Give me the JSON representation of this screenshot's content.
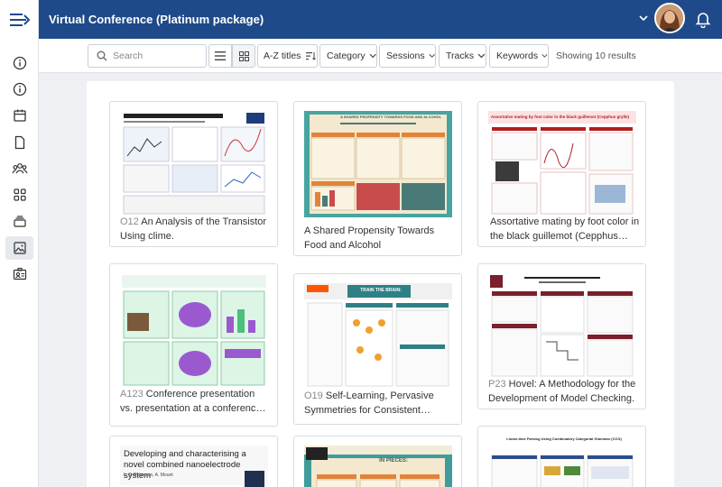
{
  "header": {
    "title": "Virtual Conference (Platinum package)"
  },
  "sidebar": {
    "items": [
      {
        "icon": "info-icon"
      },
      {
        "icon": "info-icon"
      },
      {
        "icon": "calendar-icon"
      },
      {
        "icon": "document-icon"
      },
      {
        "icon": "people-icon"
      },
      {
        "icon": "apps-grid-icon"
      },
      {
        "icon": "stack-icon"
      },
      {
        "icon": "image-icon",
        "active": true
      },
      {
        "icon": "badge-icon"
      }
    ]
  },
  "toolbar": {
    "search_placeholder": "Search",
    "sort_label": "A-Z titles",
    "filters": {
      "category": "Category",
      "sessions": "Sessions",
      "tracks": "Tracks",
      "keywords": "Keywords"
    },
    "results": "Showing 10 results"
  },
  "posters": [
    {
      "code": "O12",
      "title": "An Analysis of the Transistor Using clime."
    },
    {
      "code": "",
      "title": "A Shared Propensity Towards Food and Alcohol",
      "poster_header": "A SHARED PROPENSITY TOWARDS FOOD AND ALCOHOL"
    },
    {
      "code": "",
      "title": "Assortative mating by foot color in the black guillemot (Cepphus grylle)",
      "poster_header": "Assortative mating by foot color in the black guillemot (Cepphus grylle)"
    },
    {
      "code": "A123",
      "title": "Conference presentation vs. presentation at a conference: Assessing the same phenomenon"
    },
    {
      "code": "O19",
      "title": "Self-Learning, Pervasive Symmetries for Consistent Hashing",
      "poster_header": "TRAIN THE BRAIN:"
    },
    {
      "code": "P23",
      "title": "Hovel: A Methodology for the Development of Model Checking."
    },
    {
      "code": "",
      "title": "Developing and characterising a novel combined nanoelectrode system",
      "poster_header": "Developing and characterising a novel combined nanoelectrode system",
      "poster_authors": "L. P. Robinson, A. Mount"
    },
    {
      "code": "",
      "title": "In Pieces",
      "poster_header": "IN PIECES:"
    },
    {
      "code": "",
      "title": "Linear-time Parsing Using Combinatory Categorial Grammar (CCG)",
      "poster_header": "Linear-time Parsing Using Combinatory Categorial Grammar (CCG)"
    }
  ],
  "colors": {
    "header_bg": "#1f4a8a",
    "page_bg": "#eef0f3"
  }
}
